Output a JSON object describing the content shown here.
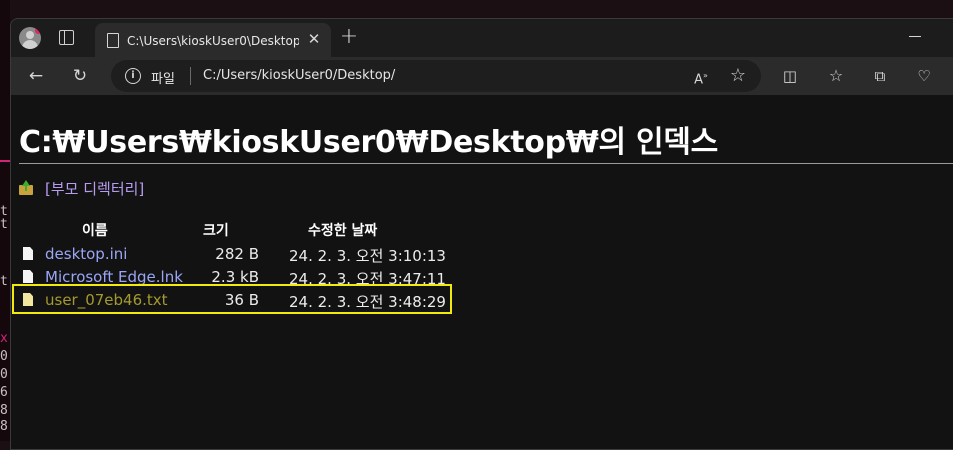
{
  "tab": {
    "title": "C:\\Users\\kioskUser0\\Desktop\\의"
  },
  "address": {
    "scheme_label": "파일",
    "url": "C:/Users/kioskUser0/Desktop/"
  },
  "page": {
    "title": "C:₩Users₩kioskUser0₩Desktop₩의 인덱스",
    "parent_link": "[부모 디렉터리]",
    "columns": {
      "name": "이름",
      "size": "크기",
      "modified": "수정한 날짜"
    },
    "files": [
      {
        "name": "desktop.ini",
        "size": "282 B",
        "modified": "24. 2. 3. 오전 3:10:13"
      },
      {
        "name": "Microsoft Edge.lnk",
        "size": "2.3 kB",
        "modified": "24. 2. 3. 오전 3:47:11"
      },
      {
        "name": "user_07eb46.txt",
        "size": "36 B",
        "modified": "24. 2. 3. 오전 3:48:29"
      }
    ]
  },
  "desktop_glyphs": [
    "t",
    "t",
    "t",
    "x",
    "0",
    "0",
    "6",
    "8",
    "8",
    "8"
  ],
  "colors": {
    "highlight": "#f2ea0d",
    "link": "#9aa6f5",
    "visited": "#a59a2e"
  }
}
